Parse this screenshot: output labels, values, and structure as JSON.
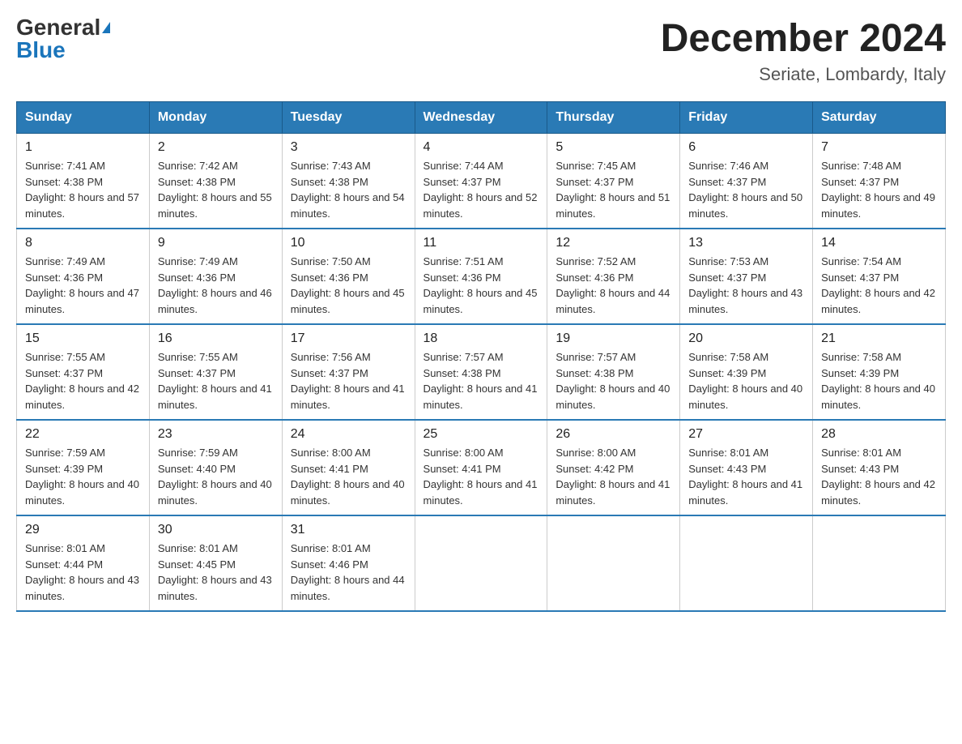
{
  "header": {
    "logo_general": "General",
    "logo_blue": "Blue",
    "month": "December 2024",
    "location": "Seriate, Lombardy, Italy"
  },
  "weekdays": [
    "Sunday",
    "Monday",
    "Tuesday",
    "Wednesday",
    "Thursday",
    "Friday",
    "Saturday"
  ],
  "weeks": [
    [
      {
        "day": "1",
        "sunrise": "7:41 AM",
        "sunset": "4:38 PM",
        "daylight": "8 hours and 57 minutes."
      },
      {
        "day": "2",
        "sunrise": "7:42 AM",
        "sunset": "4:38 PM",
        "daylight": "8 hours and 55 minutes."
      },
      {
        "day": "3",
        "sunrise": "7:43 AM",
        "sunset": "4:38 PM",
        "daylight": "8 hours and 54 minutes."
      },
      {
        "day": "4",
        "sunrise": "7:44 AM",
        "sunset": "4:37 PM",
        "daylight": "8 hours and 52 minutes."
      },
      {
        "day": "5",
        "sunrise": "7:45 AM",
        "sunset": "4:37 PM",
        "daylight": "8 hours and 51 minutes."
      },
      {
        "day": "6",
        "sunrise": "7:46 AM",
        "sunset": "4:37 PM",
        "daylight": "8 hours and 50 minutes."
      },
      {
        "day": "7",
        "sunrise": "7:48 AM",
        "sunset": "4:37 PM",
        "daylight": "8 hours and 49 minutes."
      }
    ],
    [
      {
        "day": "8",
        "sunrise": "7:49 AM",
        "sunset": "4:36 PM",
        "daylight": "8 hours and 47 minutes."
      },
      {
        "day": "9",
        "sunrise": "7:49 AM",
        "sunset": "4:36 PM",
        "daylight": "8 hours and 46 minutes."
      },
      {
        "day": "10",
        "sunrise": "7:50 AM",
        "sunset": "4:36 PM",
        "daylight": "8 hours and 45 minutes."
      },
      {
        "day": "11",
        "sunrise": "7:51 AM",
        "sunset": "4:36 PM",
        "daylight": "8 hours and 45 minutes."
      },
      {
        "day": "12",
        "sunrise": "7:52 AM",
        "sunset": "4:36 PM",
        "daylight": "8 hours and 44 minutes."
      },
      {
        "day": "13",
        "sunrise": "7:53 AM",
        "sunset": "4:37 PM",
        "daylight": "8 hours and 43 minutes."
      },
      {
        "day": "14",
        "sunrise": "7:54 AM",
        "sunset": "4:37 PM",
        "daylight": "8 hours and 42 minutes."
      }
    ],
    [
      {
        "day": "15",
        "sunrise": "7:55 AM",
        "sunset": "4:37 PM",
        "daylight": "8 hours and 42 minutes."
      },
      {
        "day": "16",
        "sunrise": "7:55 AM",
        "sunset": "4:37 PM",
        "daylight": "8 hours and 41 minutes."
      },
      {
        "day": "17",
        "sunrise": "7:56 AM",
        "sunset": "4:37 PM",
        "daylight": "8 hours and 41 minutes."
      },
      {
        "day": "18",
        "sunrise": "7:57 AM",
        "sunset": "4:38 PM",
        "daylight": "8 hours and 41 minutes."
      },
      {
        "day": "19",
        "sunrise": "7:57 AM",
        "sunset": "4:38 PM",
        "daylight": "8 hours and 40 minutes."
      },
      {
        "day": "20",
        "sunrise": "7:58 AM",
        "sunset": "4:39 PM",
        "daylight": "8 hours and 40 minutes."
      },
      {
        "day": "21",
        "sunrise": "7:58 AM",
        "sunset": "4:39 PM",
        "daylight": "8 hours and 40 minutes."
      }
    ],
    [
      {
        "day": "22",
        "sunrise": "7:59 AM",
        "sunset": "4:39 PM",
        "daylight": "8 hours and 40 minutes."
      },
      {
        "day": "23",
        "sunrise": "7:59 AM",
        "sunset": "4:40 PM",
        "daylight": "8 hours and 40 minutes."
      },
      {
        "day": "24",
        "sunrise": "8:00 AM",
        "sunset": "4:41 PM",
        "daylight": "8 hours and 40 minutes."
      },
      {
        "day": "25",
        "sunrise": "8:00 AM",
        "sunset": "4:41 PM",
        "daylight": "8 hours and 41 minutes."
      },
      {
        "day": "26",
        "sunrise": "8:00 AM",
        "sunset": "4:42 PM",
        "daylight": "8 hours and 41 minutes."
      },
      {
        "day": "27",
        "sunrise": "8:01 AM",
        "sunset": "4:43 PM",
        "daylight": "8 hours and 41 minutes."
      },
      {
        "day": "28",
        "sunrise": "8:01 AM",
        "sunset": "4:43 PM",
        "daylight": "8 hours and 42 minutes."
      }
    ],
    [
      {
        "day": "29",
        "sunrise": "8:01 AM",
        "sunset": "4:44 PM",
        "daylight": "8 hours and 43 minutes."
      },
      {
        "day": "30",
        "sunrise": "8:01 AM",
        "sunset": "4:45 PM",
        "daylight": "8 hours and 43 minutes."
      },
      {
        "day": "31",
        "sunrise": "8:01 AM",
        "sunset": "4:46 PM",
        "daylight": "8 hours and 44 minutes."
      },
      null,
      null,
      null,
      null
    ]
  ]
}
